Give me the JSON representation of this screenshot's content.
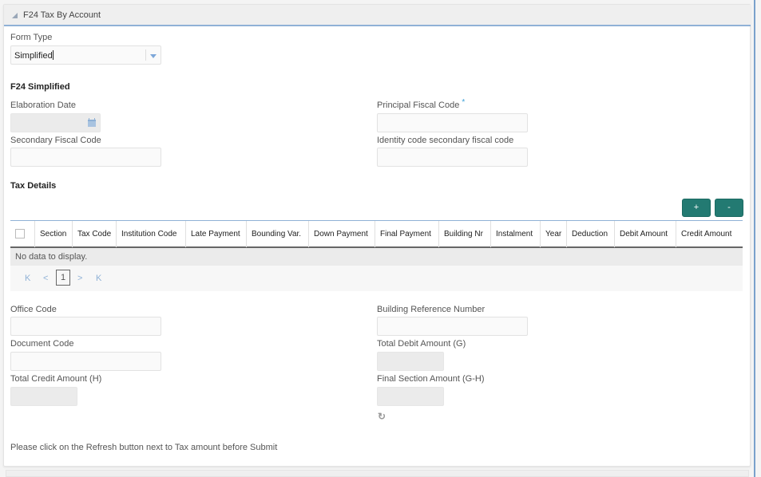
{
  "panel": {
    "title": "F24 Tax By Account"
  },
  "form_type": {
    "label": "Form Type",
    "value": "Simplified"
  },
  "f24_simplified": {
    "title": "F24 Simplified",
    "elaboration_date_label": "Elaboration Date",
    "principal_fiscal_code_label": "Principal Fiscal Code",
    "required_marker": "*",
    "secondary_fiscal_code_label": "Secondary Fiscal Code",
    "identity_code_label": "Identity code secondary fiscal code"
  },
  "tax_details": {
    "title": "Tax Details",
    "add_button": "+",
    "remove_button": "-",
    "columns": [
      "Section",
      "Tax Code",
      "Institution Code",
      "Late Payment",
      "Bounding Var.",
      "Down Payment",
      "Final Payment",
      "Building Nr",
      "Instalment",
      "Year",
      "Deduction",
      "Debit Amount",
      "Credit Amount"
    ],
    "empty_message": "No data to display.",
    "pager": {
      "first": "K",
      "prev": "<",
      "current_page": "1",
      "next": ">",
      "last": "K"
    }
  },
  "bottom_fields": {
    "office_code_label": "Office Code",
    "building_ref_label": "Building Reference Number",
    "document_code_label": "Document Code",
    "total_debit_label": "Total Debit Amount (G)",
    "total_credit_label": "Total Credit Amount (H)",
    "final_section_label": "Final Section Amount (G-H)"
  },
  "note": "Please click on the Refresh button next to Tax amount before Submit",
  "icons": {
    "collapse": "triangle-collapse-icon",
    "dropdown": "chevron-down-icon",
    "calendar": "calendar-icon",
    "refresh": "refresh-icon"
  },
  "colors": {
    "accent_button": "#237a72",
    "header_rule": "#8fb1d6",
    "required": "#3aa0d8"
  }
}
